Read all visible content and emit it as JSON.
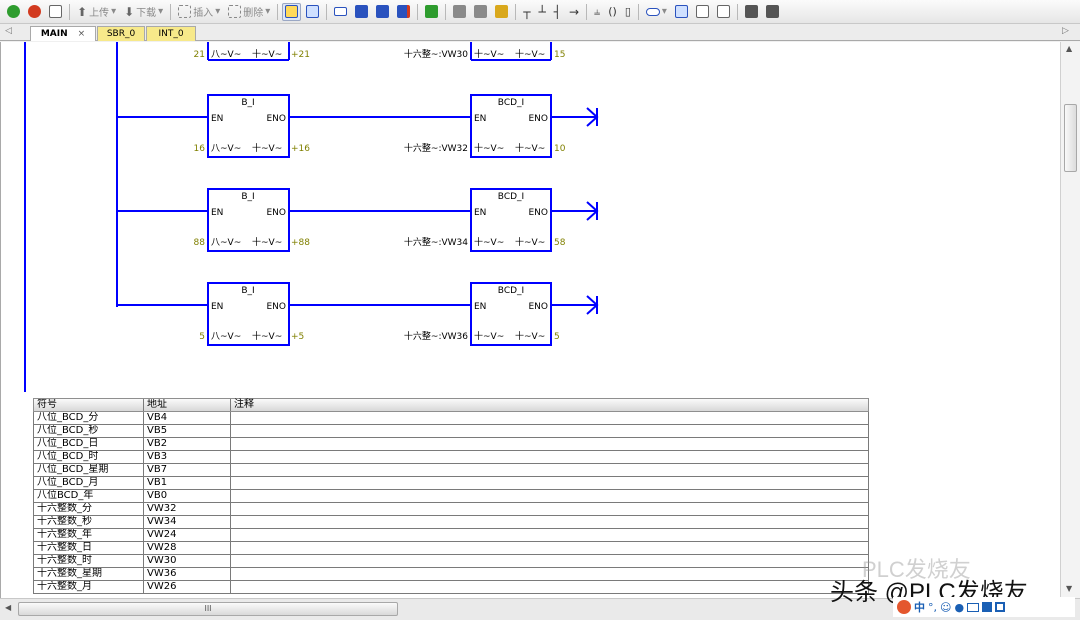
{
  "toolbar": {
    "upload_label": "上传",
    "download_label": "下载",
    "insert_label": "插入",
    "delete_label": "删除"
  },
  "tabs": [
    {
      "label": "MAIN",
      "close": "×",
      "color": "#ffffff"
    },
    {
      "label": "SBR_0",
      "color": "#f7e98a"
    },
    {
      "label": "INT_0",
      "color": "#f7e98a"
    }
  ],
  "ladder": {
    "top_row": {
      "in_value": "21",
      "in_param": "八~V~",
      "out_param": "十~V~",
      "out_value": "+21",
      "bcd_in_label": "十六整~:VW30",
      "bcd_in_param": "十~V~",
      "bcd_out_param": "十~V~",
      "bcd_out_value": "15"
    },
    "rows": [
      {
        "b_title": "B_I",
        "bcd_title": "BCD_I",
        "en": "EN",
        "eno": "ENO",
        "in_value": "16",
        "in_param": "八~V~",
        "out_param": "十~V~",
        "out_value": "+16",
        "bcd_in_label": "十六整~:VW32",
        "bcd_in_param": "十~V~",
        "bcd_out_param": "十~V~",
        "bcd_out_value": "10"
      },
      {
        "b_title": "B_I",
        "bcd_title": "BCD_I",
        "en": "EN",
        "eno": "ENO",
        "in_value": "88",
        "in_param": "八~V~",
        "out_param": "十~V~",
        "out_value": "+88",
        "bcd_in_label": "十六整~:VW34",
        "bcd_in_param": "十~V~",
        "bcd_out_param": "十~V~",
        "bcd_out_value": "58"
      },
      {
        "b_title": "B_I",
        "bcd_title": "BCD_I",
        "en": "EN",
        "eno": "ENO",
        "in_value": "5",
        "in_param": "八~V~",
        "out_param": "十~V~",
        "out_value": "+5",
        "bcd_in_label": "十六整~:VW36",
        "bcd_in_param": "十~V~",
        "bcd_out_param": "十~V~",
        "bcd_out_value": "5"
      }
    ]
  },
  "symbol_table": {
    "headers": {
      "symbol": "符号",
      "address": "地址",
      "comment": "注释"
    },
    "rows": [
      {
        "symbol": "八位_BCD_分",
        "address": "VB4"
      },
      {
        "symbol": "八位_BCD_秒",
        "address": "VB5"
      },
      {
        "symbol": "八位_BCD_日",
        "address": "VB2"
      },
      {
        "symbol": "八位_BCD_时",
        "address": "VB3"
      },
      {
        "symbol": "八位_BCD_星期",
        "address": "VB7"
      },
      {
        "symbol": "八位_BCD_月",
        "address": "VB1"
      },
      {
        "symbol": "八位BCD_年",
        "address": "VB0"
      },
      {
        "symbol": "十六整数_分",
        "address": "VW32"
      },
      {
        "symbol": "十六整数_秒",
        "address": "VW34"
      },
      {
        "symbol": "十六整数_年",
        "address": "VW24"
      },
      {
        "symbol": "十六整数_日",
        "address": "VW28"
      },
      {
        "symbol": "十六整数_时",
        "address": "VW30"
      },
      {
        "symbol": "十六整数_星期",
        "address": "VW36"
      },
      {
        "symbol": "十六整数_月",
        "address": "VW26"
      }
    ]
  },
  "hscroll": {
    "grip": "III"
  },
  "watermark": {
    "faded": "PLC发烧友",
    "main": "头条 @PLC发烧友"
  },
  "ime": {
    "lang": "中",
    "punct": "°,"
  },
  "colors": {
    "wire": "#0000ff",
    "value": "#808000",
    "tab_active": "#ffffff",
    "tab_inactive": "#f7e98a"
  }
}
